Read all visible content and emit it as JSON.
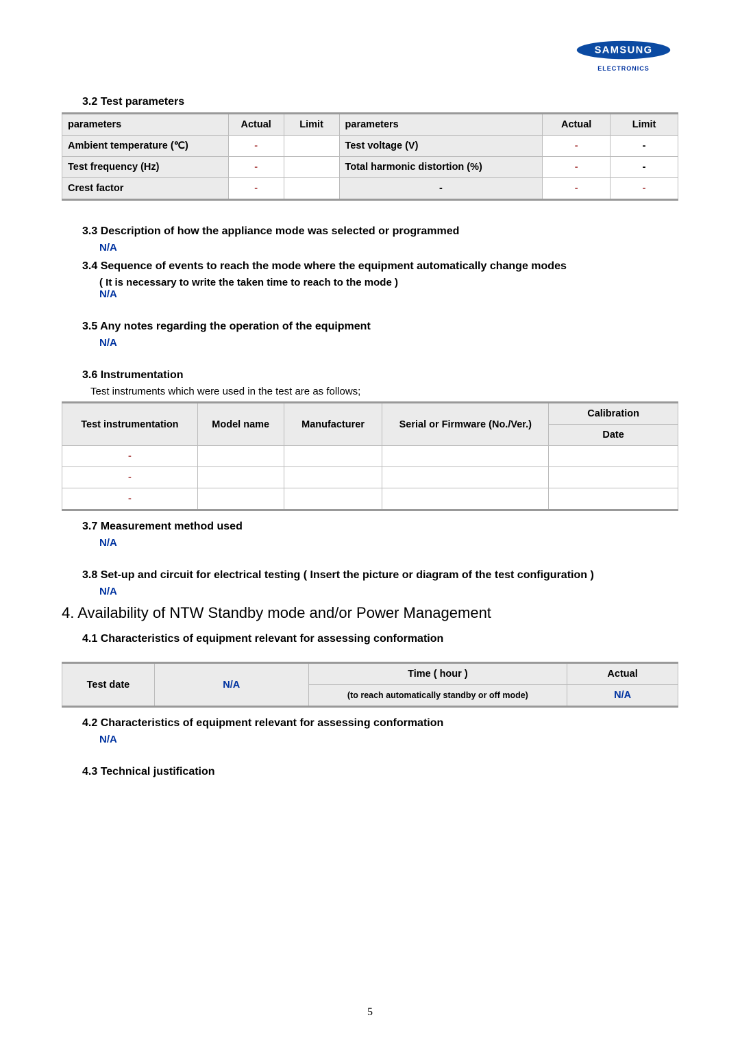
{
  "logo": {
    "brand": "SAMSUNG",
    "sub": "ELECTRONICS"
  },
  "s32": {
    "title": "3.2 Test parameters",
    "headers": {
      "params": "parameters",
      "actual": "Actual",
      "limit": "Limit"
    },
    "rows": [
      {
        "l": "Ambient temperature (℃)",
        "la": "-",
        "ll": "",
        "r": "Test voltage (V)",
        "ra": "-",
        "rl": "-"
      },
      {
        "l": "Test frequency (Hz)",
        "la": "-",
        "ll": "",
        "r": "Total harmonic distortion (%)",
        "ra": "-",
        "rl": "-"
      },
      {
        "l": "Crest factor",
        "la": "-",
        "ll": "",
        "r": "-",
        "ra": "-",
        "rl": "-"
      }
    ]
  },
  "s33": {
    "title": "3.3 Description of how the appliance mode was selected or programmed",
    "val": "N/A"
  },
  "s34": {
    "title": "3.4 Sequence of events to reach the mode where the equipment automatically change modes",
    "sub": "( It is necessary to write the taken time to reach to the mode )",
    "val": "N/A"
  },
  "s35": {
    "title": "3.5 Any notes regarding the operation of the equipment",
    "val": "N/A"
  },
  "s36": {
    "title": "3.6 Instrumentation",
    "note": "Test instruments which were used in the test are as follows;",
    "headers": {
      "ti": "Test instrumentation",
      "mn": "Model name",
      "mf": "Manufacturer",
      "sf": "Serial or Firmware (No./Ver.)",
      "cal": "Calibration",
      "date": "Date"
    },
    "rows": [
      {
        "c1": "-"
      },
      {
        "c1": "-"
      },
      {
        "c1": "-"
      }
    ]
  },
  "s37": {
    "title": "3.7 Measurement method used",
    "val": "N/A"
  },
  "s38": {
    "title": "3.8 Set-up and circuit for electrical testing ( Insert the picture or diagram of the test configuration )",
    "val": "N/A"
  },
  "s4": {
    "title": "4. Availability of NTW Standby mode and/or Power Management"
  },
  "s41": {
    "title": "4.1 Characteristics of equipment relevant for assessing conformation",
    "headers": {
      "td": "Test date",
      "na": "N/A",
      "time": "Time ( hour )",
      "sub": "(to reach automatically standby or off mode)",
      "actual": "Actual",
      "val": "N/A"
    }
  },
  "s42": {
    "title": "4.2 Characteristics of equipment relevant for assessing conformation",
    "val": "N/A"
  },
  "s43": {
    "title": "4.3 Technical justification"
  },
  "pagenum": "5"
}
